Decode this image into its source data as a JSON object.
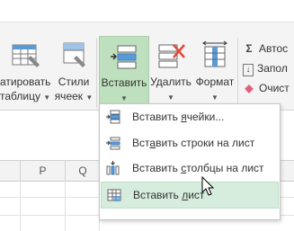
{
  "ribbon": {
    "format_table": {
      "line1": "атировать",
      "line2": "таблицу"
    },
    "cell_styles": {
      "line1": "Стили",
      "line2": "ячеек"
    },
    "insert": {
      "label": "Вставить"
    },
    "delete": {
      "label": "Удалить"
    },
    "format": {
      "label": "Формат"
    },
    "autosum": {
      "label": "Автос"
    },
    "fill": {
      "label": "Запол"
    },
    "clear": {
      "label": "Очист"
    }
  },
  "columns": [
    "P",
    "Q"
  ],
  "menu": {
    "items": [
      {
        "pre": "Вставить ",
        "ul": "я",
        "post": "чейки...",
        "icon": "insert-cells-icon"
      },
      {
        "pre": "Вст",
        "ul": "а",
        "post": "вить строки на лист",
        "icon": "insert-rows-icon"
      },
      {
        "pre": "Вставить ",
        "ul": "с",
        "post": "толбцы на лист",
        "icon": "insert-columns-icon"
      },
      {
        "pre": "Вставить ",
        "ul": "л",
        "post": "ист",
        "icon": "insert-sheet-icon"
      }
    ]
  },
  "colors": {
    "insert_highlight": "#bfe0bf",
    "menu_highlight": "#d6ecdd"
  }
}
